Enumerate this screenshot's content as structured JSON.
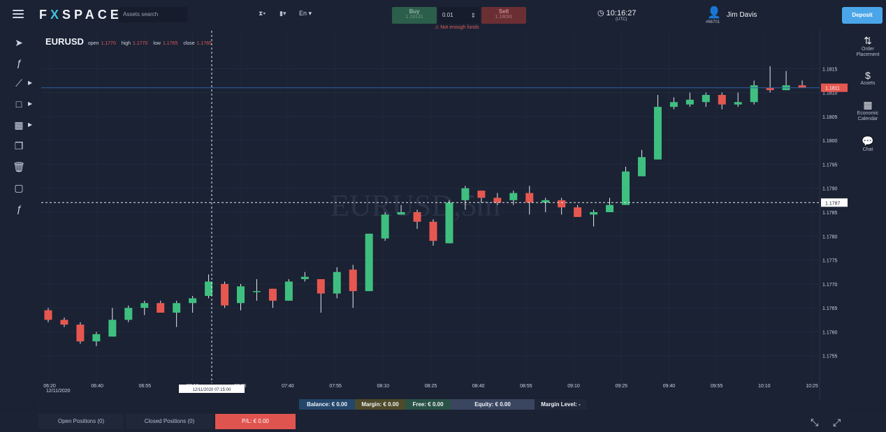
{
  "header": {
    "logo": "FXSPACE",
    "search_placeholder": "Assets search",
    "lang": "En",
    "buy": {
      "label": "Buy",
      "price": "1.18131"
    },
    "sell": {
      "label": "Sell",
      "price": "1.18091"
    },
    "quantity": "0.01",
    "funds_warning": "Not enough funds",
    "time": "10:16:27",
    "timezone": "(UTC)",
    "user_name": "Jim Davis",
    "user_id": "#66701",
    "deposit_label": "Deposit"
  },
  "left_tools": [
    "cursor-icon",
    "function-icon",
    "trendline-icon",
    "rectangle-icon",
    "grid-icon",
    "copy-icon",
    "trash-icon",
    "snapshot-icon",
    "clear-function-icon"
  ],
  "right_menu": [
    {
      "icon": "order-icon",
      "label": "Order Placement"
    },
    {
      "icon": "dollar-icon",
      "label": "Assets"
    },
    {
      "icon": "calendar-icon",
      "label": "Economic Calendar"
    },
    {
      "icon": "chat-icon",
      "label": "Chat"
    }
  ],
  "ohlc": {
    "symbol": "EURUSD",
    "open_label": "open",
    "open": "1.1770",
    "high_label": "high",
    "high": "1.1770",
    "low_label": "low",
    "low": "1.1765",
    "close_label": "close",
    "close": "1.1765"
  },
  "watermark": "EURUSD,5m",
  "chart_data": {
    "type": "candlestick",
    "symbol": "EURUSD",
    "timeframe": "5m",
    "ylim": [
      1.175,
      1.182
    ],
    "y_ticks": [
      "1.1755",
      "1.1760",
      "1.1765",
      "1.1770",
      "1.1775",
      "1.1780",
      "1.1785",
      "1.1790",
      "1.1795",
      "1.1800",
      "1.1805",
      "1.1810",
      "1.1815"
    ],
    "x_ticks": [
      "06:20",
      "06:40",
      "06:55",
      "07:10",
      "07:25",
      "07:40",
      "07:55",
      "08:10",
      "08:25",
      "08:40",
      "08:55",
      "09:10",
      "09:25",
      "09:40",
      "09:55",
      "10:10",
      "10:25"
    ],
    "x_date": "12/11/2020",
    "crosshair_label": "12/11/2020 07:15:00",
    "price_line_label": "1.1811",
    "crosshair_price_label": "1.1787",
    "colors": {
      "up": "#3fbf7f",
      "down": "#e6574f",
      "background": "#1b2233"
    },
    "candles": [
      {
        "o": 1.17645,
        "h": 1.1765,
        "l": 1.1762,
        "c": 1.17625
      },
      {
        "o": 1.17625,
        "h": 1.1763,
        "l": 1.1761,
        "c": 1.17615
      },
      {
        "o": 1.17615,
        "h": 1.1762,
        "l": 1.17575,
        "c": 1.1758
      },
      {
        "o": 1.1758,
        "h": 1.176,
        "l": 1.1757,
        "c": 1.17595
      },
      {
        "o": 1.1759,
        "h": 1.1765,
        "l": 1.1759,
        "c": 1.17625
      },
      {
        "o": 1.17625,
        "h": 1.17655,
        "l": 1.1762,
        "c": 1.1765
      },
      {
        "o": 1.1765,
        "h": 1.17665,
        "l": 1.17635,
        "c": 1.1766
      },
      {
        "o": 1.1766,
        "h": 1.17665,
        "l": 1.1764,
        "c": 1.1764
      },
      {
        "o": 1.1764,
        "h": 1.17665,
        "l": 1.1761,
        "c": 1.1766
      },
      {
        "o": 1.1766,
        "h": 1.17675,
        "l": 1.1764,
        "c": 1.1767
      },
      {
        "o": 1.17675,
        "h": 1.1772,
        "l": 1.1767,
        "c": 1.17705
      },
      {
        "o": 1.177,
        "h": 1.17705,
        "l": 1.1765,
        "c": 1.17655
      },
      {
        "o": 1.1766,
        "h": 1.177,
        "l": 1.17645,
        "c": 1.17695
      },
      {
        "o": 1.17685,
        "h": 1.1771,
        "l": 1.17665,
        "c": 1.17685
      },
      {
        "o": 1.1769,
        "h": 1.1769,
        "l": 1.1765,
        "c": 1.17665
      },
      {
        "o": 1.17665,
        "h": 1.1771,
        "l": 1.17665,
        "c": 1.17705
      },
      {
        "o": 1.1771,
        "h": 1.17725,
        "l": 1.17705,
        "c": 1.17715
      },
      {
        "o": 1.1771,
        "h": 1.1771,
        "l": 1.1764,
        "c": 1.1768
      },
      {
        "o": 1.1768,
        "h": 1.17735,
        "l": 1.1767,
        "c": 1.17725
      },
      {
        "o": 1.1773,
        "h": 1.1774,
        "l": 1.1765,
        "c": 1.17685
      },
      {
        "o": 1.17685,
        "h": 1.17805,
        "l": 1.17685,
        "c": 1.17805
      },
      {
        "o": 1.17795,
        "h": 1.1785,
        "l": 1.1779,
        "c": 1.17845
      },
      {
        "o": 1.17845,
        "h": 1.17865,
        "l": 1.17845,
        "c": 1.1785
      },
      {
        "o": 1.1785,
        "h": 1.17855,
        "l": 1.17815,
        "c": 1.1783
      },
      {
        "o": 1.1783,
        "h": 1.17835,
        "l": 1.1778,
        "c": 1.1779
      },
      {
        "o": 1.17785,
        "h": 1.17875,
        "l": 1.17785,
        "c": 1.1787
      },
      {
        "o": 1.17875,
        "h": 1.17905,
        "l": 1.17855,
        "c": 1.179
      },
      {
        "o": 1.17895,
        "h": 1.17895,
        "l": 1.1787,
        "c": 1.1788
      },
      {
        "o": 1.1788,
        "h": 1.1789,
        "l": 1.17865,
        "c": 1.1787
      },
      {
        "o": 1.17875,
        "h": 1.17895,
        "l": 1.17865,
        "c": 1.1789
      },
      {
        "o": 1.1789,
        "h": 1.17905,
        "l": 1.17845,
        "c": 1.1787
      },
      {
        "o": 1.1787,
        "h": 1.1788,
        "l": 1.1785,
        "c": 1.17875
      },
      {
        "o": 1.17875,
        "h": 1.1788,
        "l": 1.17845,
        "c": 1.1786
      },
      {
        "o": 1.1786,
        "h": 1.17865,
        "l": 1.1784,
        "c": 1.1784
      },
      {
        "o": 1.17845,
        "h": 1.17855,
        "l": 1.1782,
        "c": 1.1785
      },
      {
        "o": 1.1785,
        "h": 1.1788,
        "l": 1.1785,
        "c": 1.17865
      },
      {
        "o": 1.17865,
        "h": 1.17945,
        "l": 1.17865,
        "c": 1.17935
      },
      {
        "o": 1.17925,
        "h": 1.1798,
        "l": 1.17925,
        "c": 1.17965
      },
      {
        "o": 1.1796,
        "h": 1.18095,
        "l": 1.1796,
        "c": 1.1807
      },
      {
        "o": 1.1807,
        "h": 1.1809,
        "l": 1.18065,
        "c": 1.1808
      },
      {
        "o": 1.18075,
        "h": 1.181,
        "l": 1.1807,
        "c": 1.18085
      },
      {
        "o": 1.1808,
        "h": 1.181,
        "l": 1.1807,
        "c": 1.18095
      },
      {
        "o": 1.18095,
        "h": 1.181,
        "l": 1.18065,
        "c": 1.18075
      },
      {
        "o": 1.18075,
        "h": 1.181,
        "l": 1.1807,
        "c": 1.1808
      },
      {
        "o": 1.1808,
        "h": 1.18125,
        "l": 1.18075,
        "c": 1.18115
      },
      {
        "o": 1.1811,
        "h": 1.18155,
        "l": 1.181,
        "c": 1.18105
      },
      {
        "o": 1.18105,
        "h": 1.18145,
        "l": 1.18105,
        "c": 1.18115
      },
      {
        "o": 1.18115,
        "h": 1.18125,
        "l": 1.1811,
        "c": 1.1811
      }
    ]
  },
  "status": {
    "balance": "Balance: € 0.00",
    "margin": "Margin: € 0.00",
    "free": "Free: € 0.00",
    "equity": "Equity: € 0.00",
    "margin_level": "Margin Level: -"
  },
  "footer": {
    "open_positions": "Open Positions  (0)",
    "closed_positions": "Closed Positions  (0)",
    "pl": "P/L: € 0.00"
  }
}
